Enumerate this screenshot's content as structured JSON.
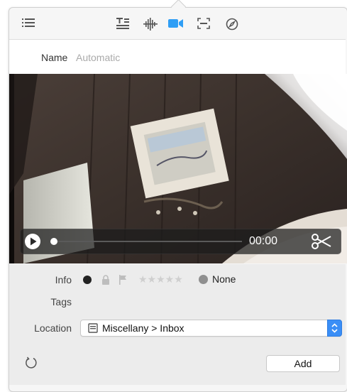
{
  "toolbar": {
    "icons": [
      "list-icon",
      "text-icon",
      "waveform-icon",
      "video-camera-icon",
      "scan-icon",
      "compass-icon"
    ],
    "active_color": "#2f9ef5"
  },
  "name": {
    "label": "Name",
    "placeholder": "Automatic"
  },
  "video": {
    "time": "00:00",
    "progress": 0.0
  },
  "info": {
    "label": "Info",
    "rating_stars": "★★★★★",
    "rating": 0,
    "label_color": "None"
  },
  "tags": {
    "label": "Tags"
  },
  "location": {
    "label": "Location",
    "value": "Miscellany > Inbox"
  },
  "buttons": {
    "add": "Add"
  }
}
